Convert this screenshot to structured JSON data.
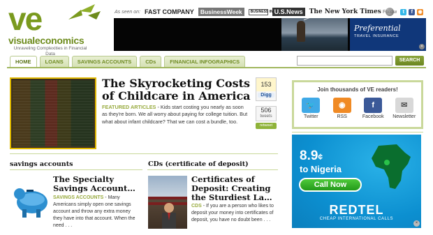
{
  "logo": {
    "mark": "ve",
    "name": "visualeconomics",
    "tagline": "Unraveling Complexities in Financial Data"
  },
  "as_seen_on": {
    "label": "As seen on:",
    "outlets": [
      "FAST COMPANY",
      "BusinessWeek",
      "BUSINESS INSIDER",
      "U.S.News",
      "The New York Times"
    ]
  },
  "follow": {
    "label": "Follow",
    "icons": [
      "twitter-icon",
      "facebook-icon",
      "rss-icon"
    ]
  },
  "banner_ad": {
    "title": "Preferential",
    "subtitle": "TRAVEL INSURANCE"
  },
  "nav": {
    "tabs": [
      "HOME",
      "LOANS",
      "SAVINGS ACCOUNTS",
      "CDs",
      "FINANCIAL INFOGRAPHICS"
    ],
    "active": "HOME"
  },
  "search": {
    "value": "",
    "placeholder": "",
    "button": "SEARCH"
  },
  "featured": {
    "title": "The Skyrocketing Costs of Childcare in America",
    "category": "FEATURED ARTICLES",
    "excerpt": " - Kids start costing you nearly as soon as they're born. We all worry about paying for college tuition. But what about infant childcare? That we can cost a bundle, too.",
    "digg_count": "153",
    "digg_label": "Digg",
    "tweet_count": "506",
    "tweet_label": "tweets",
    "retweet_label": "retweet"
  },
  "subscribe": {
    "title": "Join thousands of VE readers!",
    "items": [
      {
        "label": "Twitter",
        "icon": "twitter-icon"
      },
      {
        "label": "RSS",
        "icon": "rss-icon"
      },
      {
        "label": "Facebook",
        "icon": "facebook-icon"
      },
      {
        "label": "Newsletter",
        "icon": "newsletter-icon"
      }
    ]
  },
  "savings": {
    "heading": "savings accounts",
    "title": "The Specialty Savings Account…",
    "category": "SAVINGS ACCOUNTS",
    "excerpt": " - Many Americans simply open one savings account and throw any extra money they have into that account. When the need . . ."
  },
  "cds": {
    "heading": "CDs (certificate of deposit)",
    "title": "Certificates of Deposit: Creating the Sturdiest La…",
    "category": "CDS",
    "excerpt": " - If you are a person who likes to deposit your money into certificates of deposit, you have no doubt been . . ."
  },
  "side_ad": {
    "price": "8.9",
    "price_unit": "¢",
    "destination": "to Nigeria",
    "cta": "Call Now",
    "brand": "REDTEL",
    "brand_sub": "CHEAP INTERNATIONAL CALLS"
  },
  "colors": {
    "accent_green": "#7a9a1e",
    "nav_line": "#9fb65c",
    "ad_blue": "#0c8fd0"
  }
}
